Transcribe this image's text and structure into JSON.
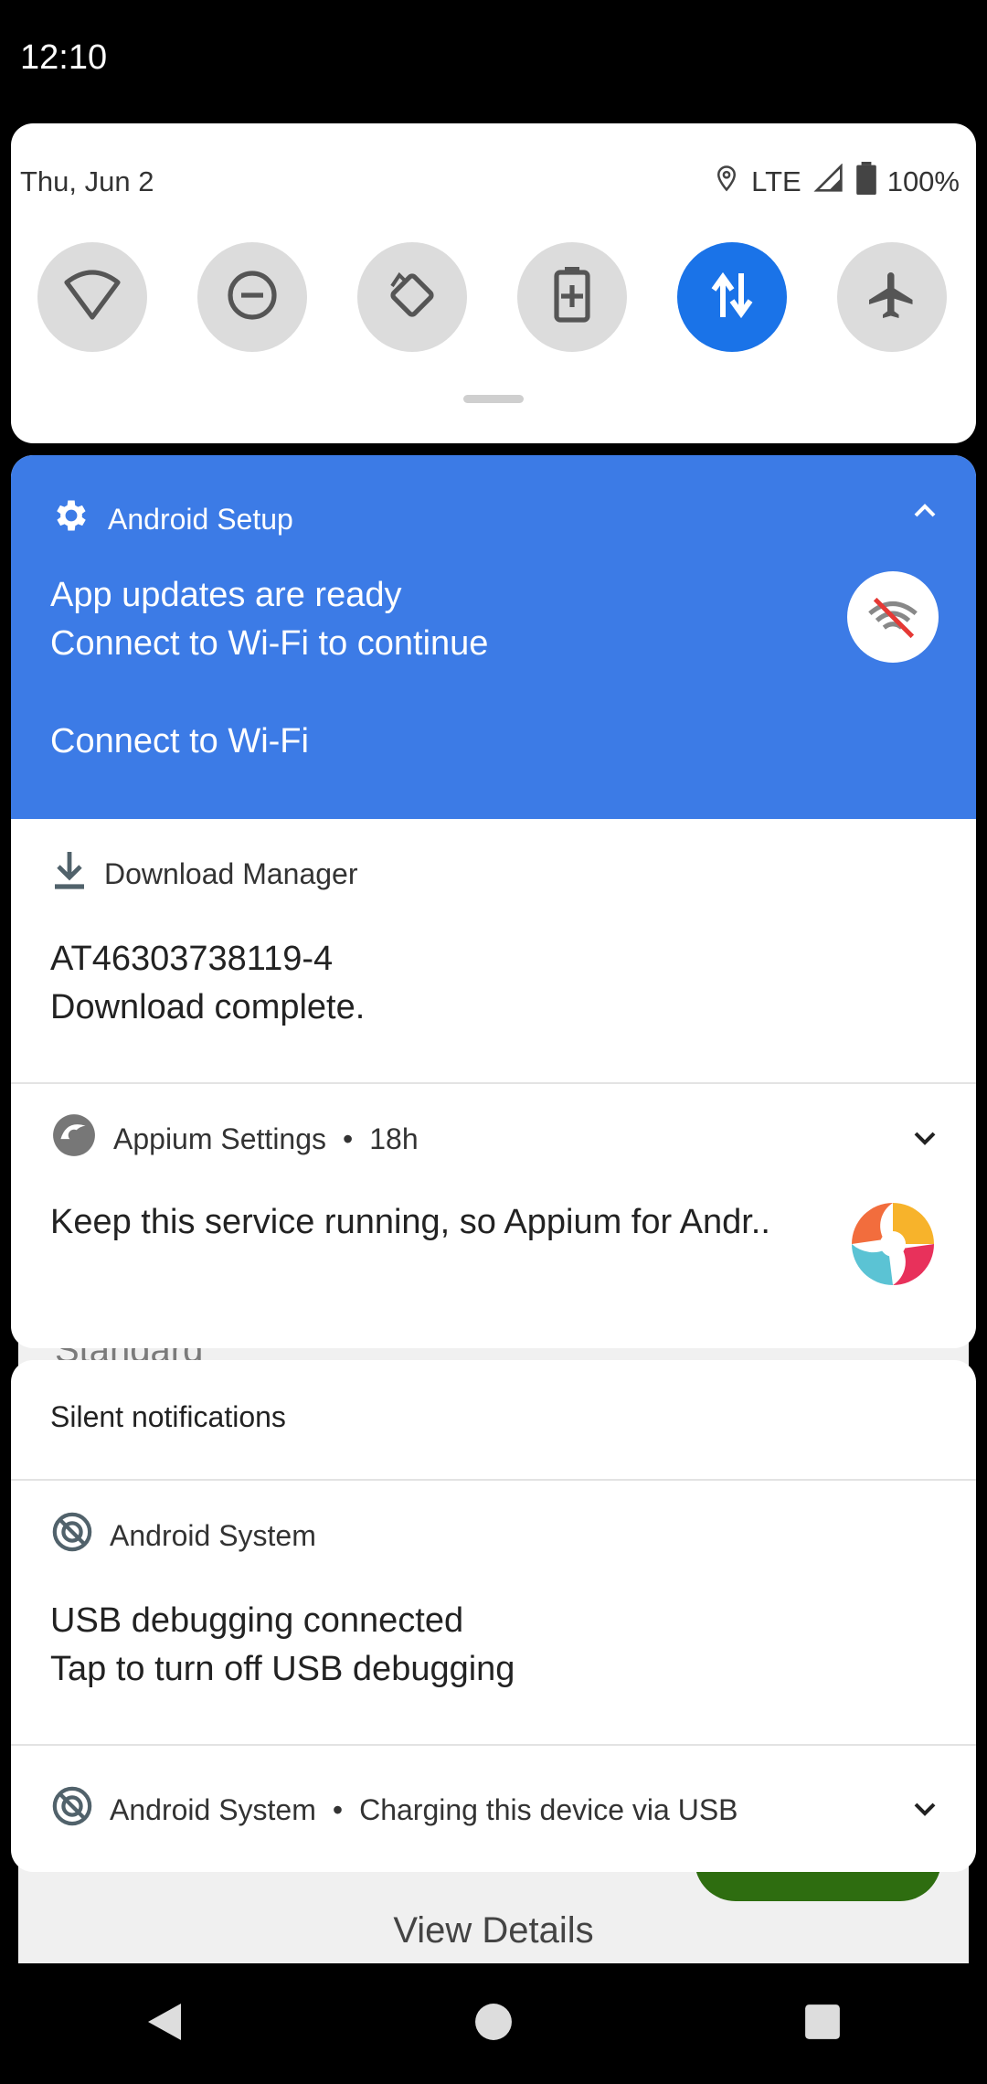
{
  "status_bar": {
    "time": "12:10"
  },
  "quick_settings": {
    "date": "Thu, Jun 2",
    "network": "LTE",
    "battery": "100%",
    "tiles": [
      {
        "name": "wifi",
        "icon": "wifi-icon",
        "on": false
      },
      {
        "name": "do-not-disturb",
        "icon": "do-not-disturb-icon",
        "on": false
      },
      {
        "name": "auto-rotate",
        "icon": "auto-rotate-icon",
        "on": false
      },
      {
        "name": "battery-saver",
        "icon": "battery-saver-icon",
        "on": false
      },
      {
        "name": "mobile-data",
        "icon": "mobile-data-icon",
        "on": true
      },
      {
        "name": "airplane-mode",
        "icon": "airplane-icon",
        "on": false
      }
    ]
  },
  "notifications": {
    "android_setup": {
      "app": "Android Setup",
      "title": "App updates are ready",
      "text": "Connect to Wi-Fi to continue",
      "action": "Connect to Wi-Fi"
    },
    "download_manager": {
      "app": "Download Manager",
      "title": "AT46303738119-4",
      "text": "Download complete."
    },
    "appium": {
      "app": "Appium Settings",
      "time": "18h",
      "text": "Keep this service running, so Appium for Andr.."
    },
    "silent_header": "Silent notifications",
    "usb_debugging": {
      "app": "Android System",
      "title": "USB debugging connected",
      "text": "Tap to turn off USB debugging"
    },
    "charging": {
      "app": "Android System",
      "text": "Charging this device via USB"
    }
  },
  "background_app": {
    "partial_text": "Standard",
    "button": "View Details"
  },
  "colors": {
    "accent": "#1a73e8",
    "setup_bg": "#3c7be6"
  }
}
